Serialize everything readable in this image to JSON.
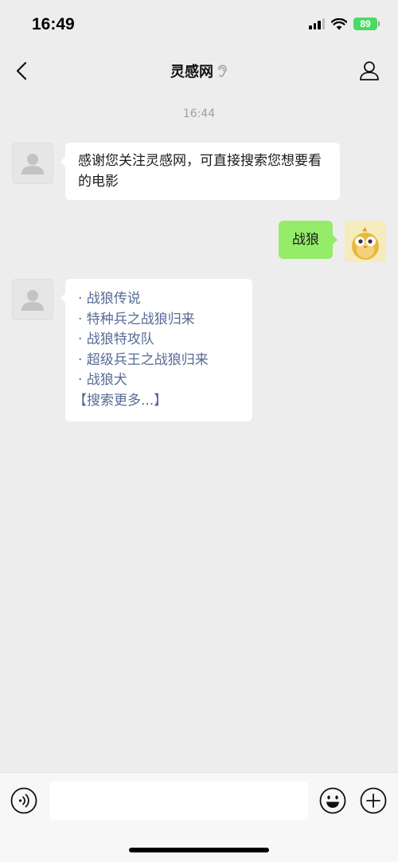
{
  "status_bar": {
    "time": "16:49",
    "battery": "89",
    "icons": [
      "signal-icon",
      "wifi-icon",
      "battery-icon"
    ]
  },
  "nav": {
    "title": "灵感网",
    "icons": [
      "back-chevron-icon",
      "ear-icon",
      "profile-icon"
    ]
  },
  "chat": {
    "timestamp": "16:44",
    "messages": [
      {
        "from": "bot",
        "text": "感谢您关注灵感网，可直接搜索您想要看的电影"
      },
      {
        "from": "me",
        "text": "战狼"
      },
      {
        "from": "bot",
        "links": [
          "· 战狼传说",
          "· 特种兵之战狼归来",
          "· 战狼特攻队",
          "· 超级兵王之战狼归来",
          "· 战狼犬",
          "【搜索更多...】"
        ]
      }
    ]
  },
  "input_bar": {
    "placeholder": "",
    "icons": [
      "voice-icon",
      "emoji-icon",
      "plus-icon"
    ]
  },
  "colors": {
    "background": "#ededed",
    "my_bubble": "#95ec69",
    "link": "#576b95",
    "battery": "#4cd964"
  }
}
